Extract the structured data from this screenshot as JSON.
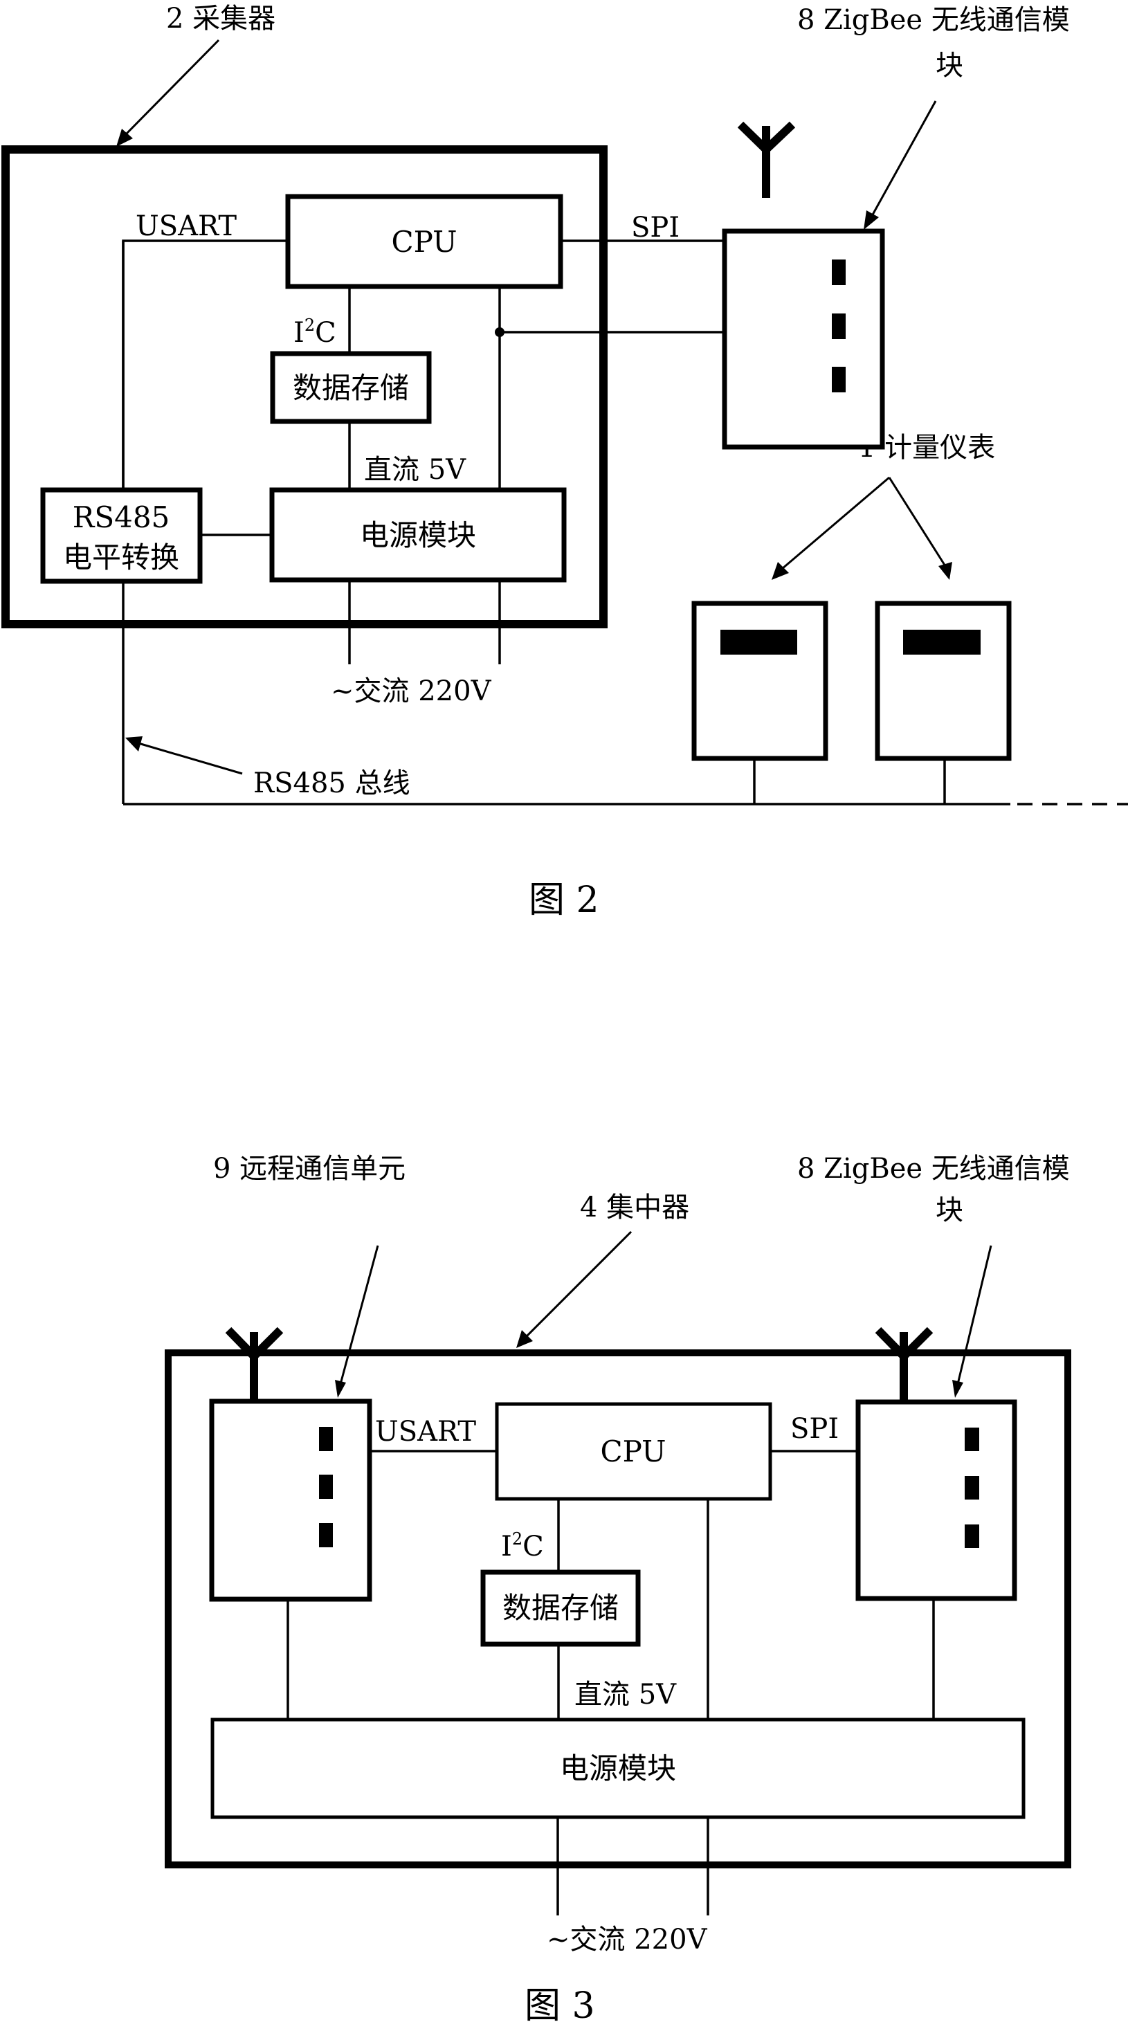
{
  "figure2": {
    "caption": "图 2",
    "collector_label": "2  采集器",
    "zigbee_label_line1": "8 ZigBee 无线通信模",
    "zigbee_label_line2": "块",
    "meters_label": "1  计量仪表",
    "cpu": "CPU",
    "usart": "USART",
    "spi": "SPI",
    "i2c_main": "I",
    "i2c_sup": "2",
    "i2c_tail": "C",
    "storage": "数据存储",
    "dc": "直流 5V",
    "power": "电源模块",
    "rs485_line1": "RS485",
    "rs485_line2": "电平转换",
    "ac": "~交流 220V",
    "bus_label": "RS485 总线"
  },
  "figure3": {
    "caption": "图  3",
    "remote_label": "9  远程通信单元",
    "concentrator_label": "4  集中器",
    "zigbee_label_line1": "8 ZigBee 无线通信模",
    "zigbee_label_line2": "块",
    "cpu": "CPU",
    "usart": "USART",
    "spi": "SPI",
    "i2c_main": "I",
    "i2c_sup": "2",
    "i2c_tail": "C",
    "storage": "数据存储",
    "dc": "直流 5V",
    "power": "电源模块",
    "ac": "~交流 220V"
  }
}
